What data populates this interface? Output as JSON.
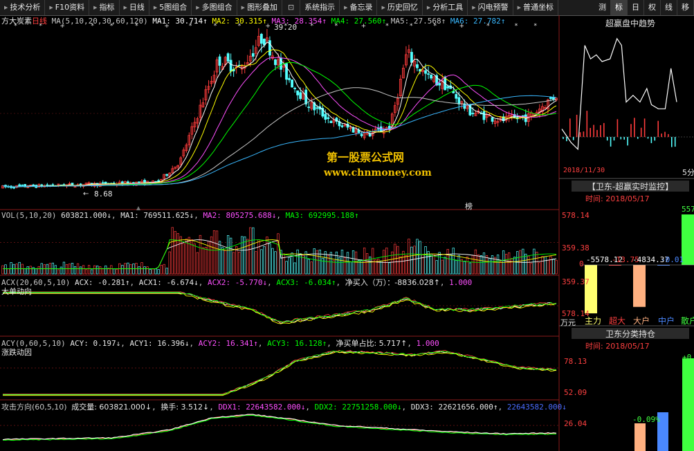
{
  "toolbar": {
    "items": [
      "技术分析",
      "F10资料",
      "指标",
      "日线",
      "5图组合",
      "多图组合",
      "图形叠加",
      "系统指示",
      "备忘录",
      "历史回忆",
      "分析工具",
      "闪电预警",
      "普通坐标"
    ],
    "right_buttons": [
      "测",
      "标",
      "日",
      "权",
      "线",
      "移"
    ]
  },
  "main_chart": {
    "title": "方大炭素",
    "period": "日线",
    "ma_prefix": "MA(5,10,20,30,60,120)",
    "ma1": "MA1: 30.714↑",
    "ma2": "MA2: 30.315↑",
    "ma3": "MA3: 28.354↑",
    "ma4": "MA4: 27.560↑",
    "ma5": "MA5: 27.568↑",
    "ma6": "MA6: 27.782↑",
    "high_label": "39.20",
    "low_label": "8.68",
    "marker_label": "榜",
    "colors": {
      "up": "#ff3c3c",
      "down": "#54ffff",
      "ma1": "#ffffff",
      "ma2": "#ffff00",
      "ma3": "#ff50ff",
      "ma4": "#00ff00",
      "ma5": "#c8c8c8",
      "ma6": "#39b8ff"
    }
  },
  "watermark": {
    "line1": "第一股票公式网",
    "line2": "www.chnmoney.com"
  },
  "vol_panel": {
    "title": "VOL(5,10,20)",
    "value": "603821.000↓",
    "ma1": "MA1: 769511.625↓",
    "ma2": "MA2: 805275.688↓",
    "ma3": "MA3: 692995.188↑"
  },
  "acx_panel": {
    "title": "ACX(20,60,5,10)",
    "acx": "ACX: -0.281↑",
    "acx1": "ACX1: -6.674↓",
    "acx2": "ACX2: -5.770↓",
    "acx3": "ACX3: -6.034↑",
    "net_buy": "净买入（万）：-8836.028↑",
    "extra": "1.000",
    "subtitle": "大单动向"
  },
  "acy_panel": {
    "title": "ACY(0,60,5,10)",
    "acy": "ACY: 0.197↓",
    "acy1": "ACY1: 16.396↓",
    "acy2": "ACY2: 16.341↑",
    "acy3": "ACY3: 16.128↑",
    "net_ratio": "净买单占比: 5.717↑",
    "extra": "1.000",
    "subtitle": "涨跌动因"
  },
  "attack_panel": {
    "title": "攻击方向(60,5,10)",
    "vol": "成交量: 603821.000↓",
    "turnover": "换手: 3.512↓",
    "ddx1": "DDX1: 22643582.000↓",
    "ddx2": "DDX2: 22751258.000↓",
    "ddx3": "DDX3: 22621656.000↑",
    "ddx4": "22643582.000↓"
  },
  "right_trend": {
    "title": "超赢盘中趋势",
    "date": "2018/11/30",
    "suffix": "5分"
  },
  "right_monitor": {
    "title": "【卫东-超赢实时监控】",
    "time": "时间: 2018/05/17",
    "axis": [
      "578.14",
      "359.38",
      "0",
      "359.37",
      "578.14"
    ],
    "values": [
      "-5578.12",
      "-13.75",
      "-4834.37",
      "-0.01"
    ],
    "right_value": "557",
    "unit": "万元",
    "categories": [
      "主力",
      "超大",
      "大户",
      "中户",
      "散户"
    ],
    "bar_values": [
      -5578.12,
      -13.75,
      -4834.37,
      -0.01,
      557
    ],
    "bar_colors": [
      "#ffff70",
      "#ff4040",
      "#ffb080",
      "#4a88ff",
      "#40ff40"
    ]
  },
  "right_holding": {
    "title": "卫东分类持仓",
    "time": "时间: 2018/05/17",
    "axis": [
      "78.13",
      "52.09",
      "26.04"
    ],
    "pct": "-0.09%",
    "right_value": "+0."
  }
}
